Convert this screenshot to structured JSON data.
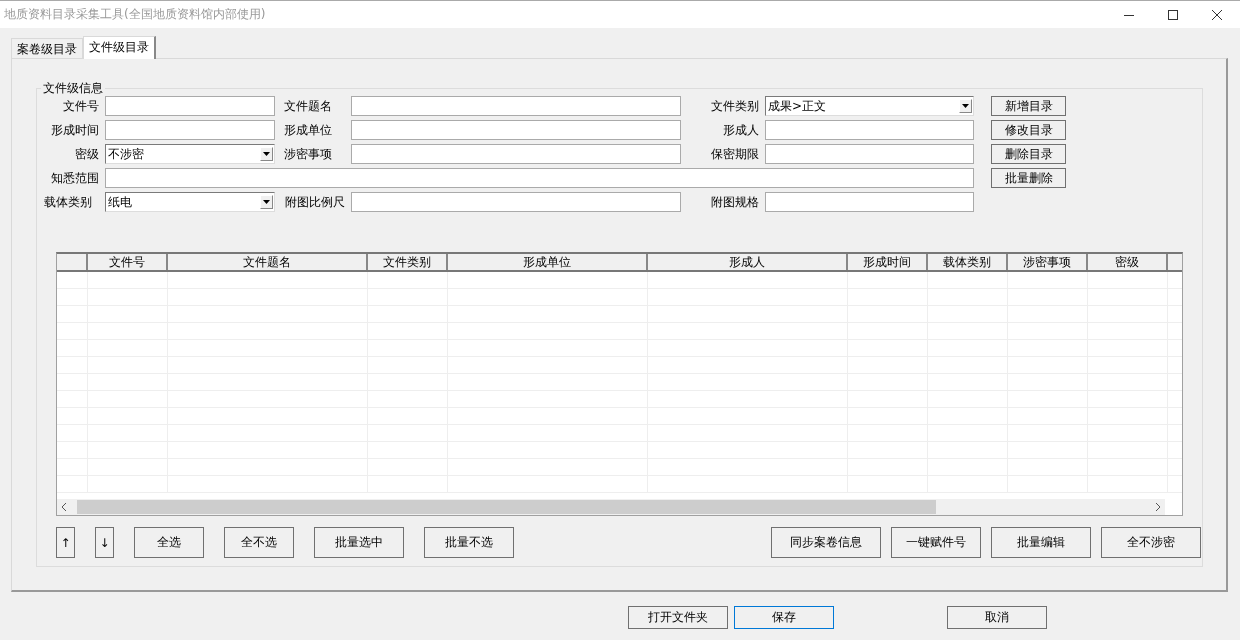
{
  "window": {
    "title": "地质资料目录采集工具(全国地质资料馆内部使用)"
  },
  "tabs": [
    {
      "label": "案卷级目录",
      "selected": false
    },
    {
      "label": "文件级目录",
      "selected": true
    }
  ],
  "group": {
    "title": "文件级信息",
    "fields": [
      {
        "label": "文件号",
        "kind": "text"
      },
      {
        "label": "文件题名",
        "kind": "text"
      },
      {
        "label": "文件类别",
        "kind": "combo",
        "value": "成果>正文"
      },
      {
        "label": "形成时间",
        "kind": "text"
      },
      {
        "label": "形成单位",
        "kind": "text"
      },
      {
        "label": "形成人",
        "kind": "text"
      },
      {
        "label": "密级",
        "kind": "combo",
        "value": "不涉密"
      },
      {
        "label": "涉密事项",
        "kind": "text"
      },
      {
        "label": "保密期限",
        "kind": "text"
      },
      {
        "label": "知悉范围",
        "kind": "wide"
      },
      {
        "label": "载体类别",
        "kind": "combo",
        "value": "纸电"
      },
      {
        "label": "附图比例尺",
        "kind": "text"
      },
      {
        "label": "附图规格",
        "kind": "text"
      }
    ],
    "side_buttons": [
      "新增目录",
      "修改目录",
      "删除目录",
      "批量删除"
    ],
    "table": {
      "columns": [
        null,
        "文件号",
        "文件题名",
        "文件类别",
        "形成单位",
        "形成人",
        "形成时间",
        "载体类别",
        "涉密事项",
        "密级",
        null
      ]
    },
    "tool_buttons": [
      {
        "label": "↑",
        "kind": "arrow"
      },
      {
        "label": "↓",
        "kind": "arrow"
      },
      {
        "label": "全选",
        "kind": "small"
      },
      {
        "label": "全不选",
        "kind": "small"
      },
      {
        "label": "批量选中",
        "kind": "medium"
      },
      {
        "label": "批量不选",
        "kind": "medium"
      }
    ],
    "action_buttons": [
      "同步案卷信息",
      "一键赋件号",
      "批量编辑",
      "全不涉密"
    ]
  },
  "footer_buttons": [
    {
      "label": "打开文件夹",
      "default": false
    },
    {
      "label": "保存",
      "default": true
    },
    {
      "label": "取消",
      "default": false
    }
  ]
}
